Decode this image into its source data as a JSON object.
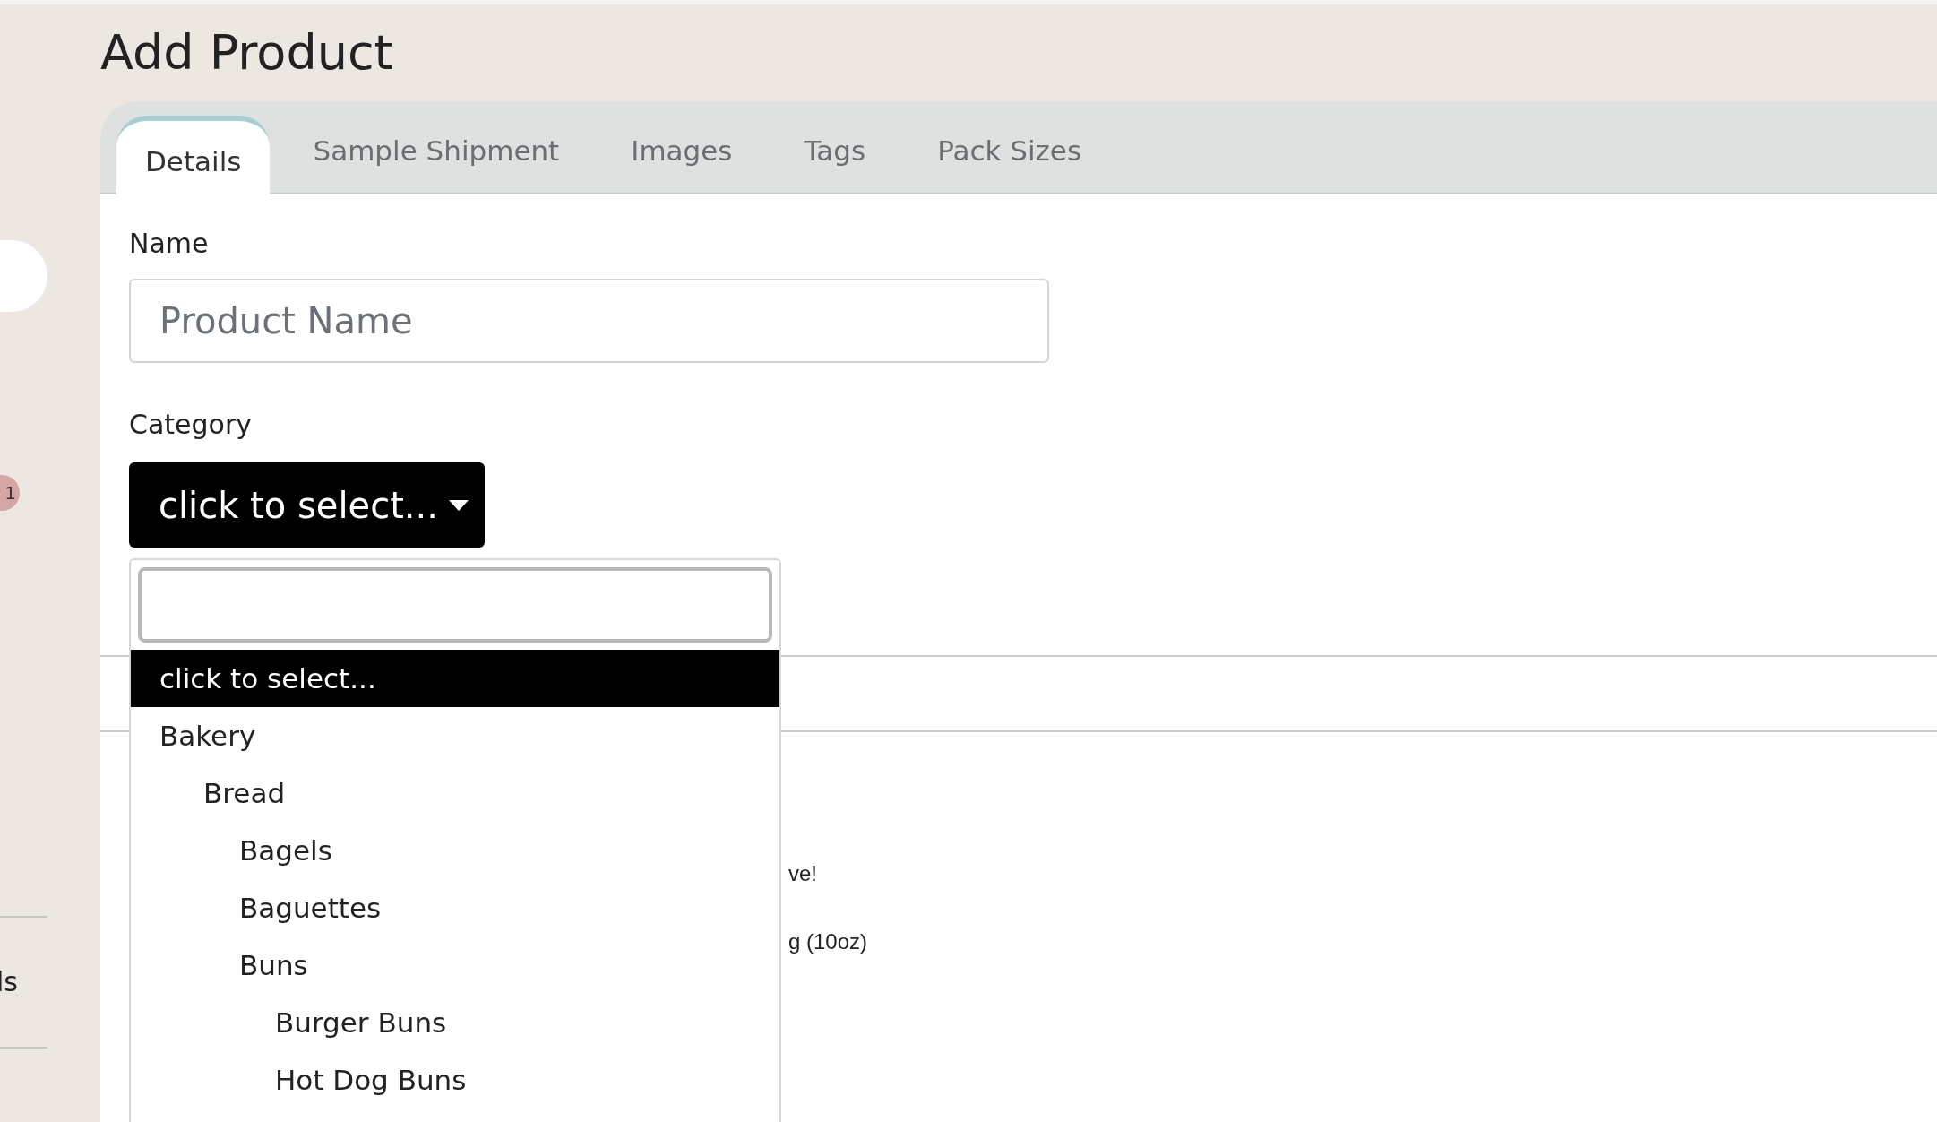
{
  "sidebar": {
    "badge": "1",
    "item_fragment": "ls"
  },
  "page": {
    "title": "Add Product"
  },
  "tabs": [
    {
      "label": "Details",
      "selected": true
    },
    {
      "label": "Sample Shipment",
      "selected": false
    },
    {
      "label": "Images",
      "selected": false
    },
    {
      "label": "Tags",
      "selected": false
    },
    {
      "label": "Pack Sizes",
      "selected": false
    }
  ],
  "name_field": {
    "label": "Name",
    "placeholder": "Product Name"
  },
  "category": {
    "label": "Category",
    "button": "click to select...",
    "expanded": true,
    "options": [
      {
        "label": "click to select...",
        "selected": true
      },
      {
        "label": "Bakery",
        "selected": false,
        "children": [
          {
            "label": "Bread",
            "selected": false,
            "children": [
              {
                "label": "Bagels",
                "selected": false
              },
              {
                "label": "Baguettes",
                "selected": false
              },
              {
                "label": "Buns",
                "selected": false,
                "children": [
                  {
                    "label": "Burger Buns",
                    "selected": false
                  },
                  {
                    "label": "Hot Dog Buns",
                    "selected": false
                  }
                ]
              }
            ]
          }
        ]
      }
    ]
  },
  "background_fragments": [
    "ve!",
    "g (10oz)"
  ]
}
